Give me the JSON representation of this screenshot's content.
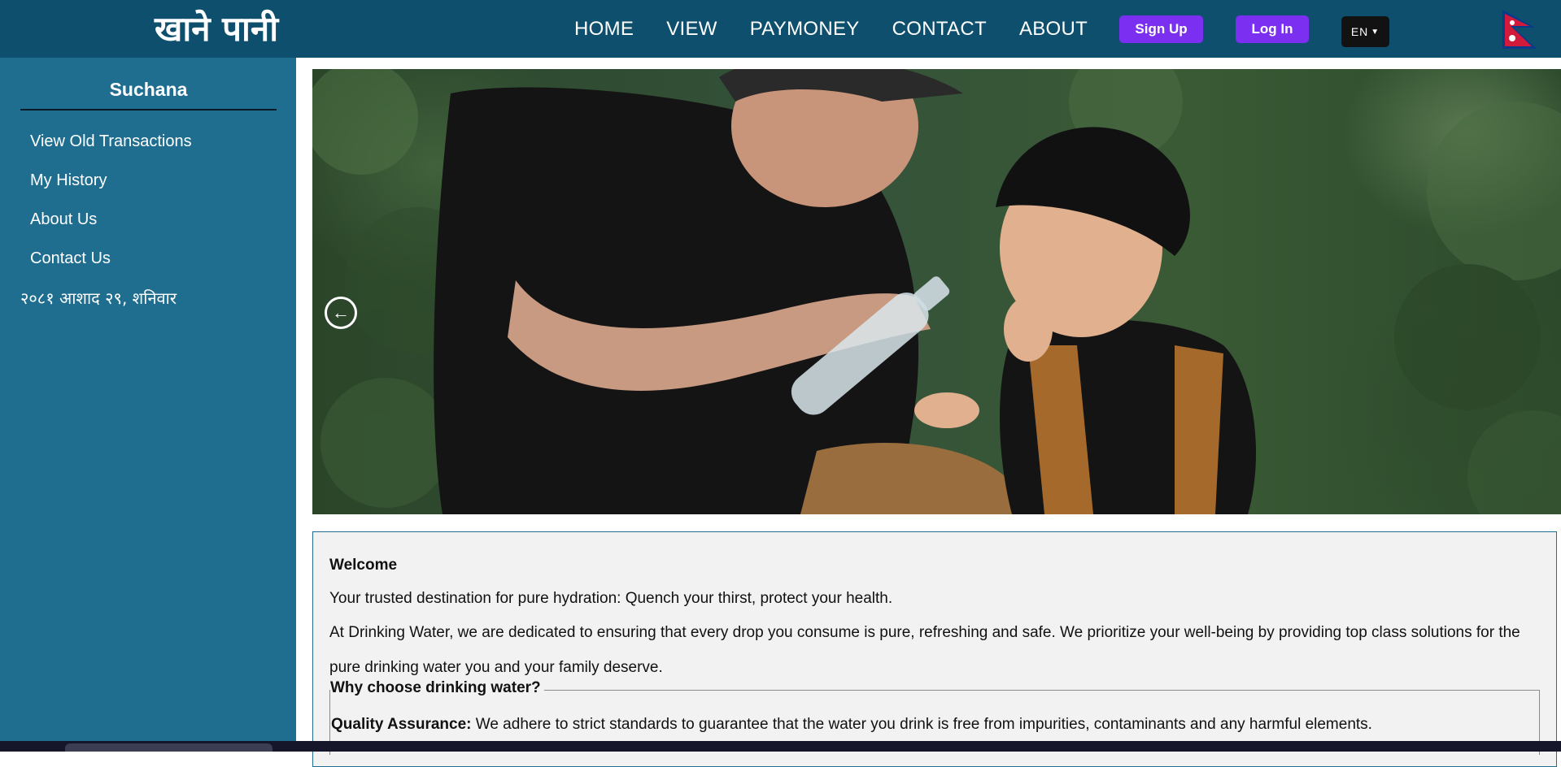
{
  "brand": {
    "title": "खाने पानी"
  },
  "nav": {
    "links": [
      "HOME",
      "VIEW",
      "PAYMONEY",
      "CONTACT",
      "ABOUT"
    ],
    "signup_label": "Sign Up",
    "login_label": "Log In",
    "language": "EN",
    "flag_icon": "nepal-flag-icon"
  },
  "sidebar": {
    "title": "Suchana",
    "items": [
      "View Old Transactions",
      "My History",
      "About Us",
      "Contact Us"
    ],
    "date": "२०८१ आशाद २९, शनिवार"
  },
  "hero": {
    "prev_icon": "arrow-left-circle-icon"
  },
  "welcome": {
    "heading": "Welcome",
    "tagline": "Your trusted destination for pure hydration: Quench your thirst, protect your health.",
    "paragraph": "At Drinking Water, we are dedicated to ensuring that every drop you consume is pure, refreshing and safe. We prioritize your well-being by providing top class solutions for the pure drinking water you and your family deserve.",
    "why_title": "Why choose drinking water?",
    "quality_label": "Quality Assurance:",
    "quality_text": " We adhere to strict standards to guarantee that the water you drink is free from impurities, contaminants and any harmful elements."
  },
  "colors": {
    "navbar": "#0e4f6e",
    "sidebar": "#1f6e90",
    "button": "#7b2ff0",
    "card_bg": "#f2f2f2"
  }
}
